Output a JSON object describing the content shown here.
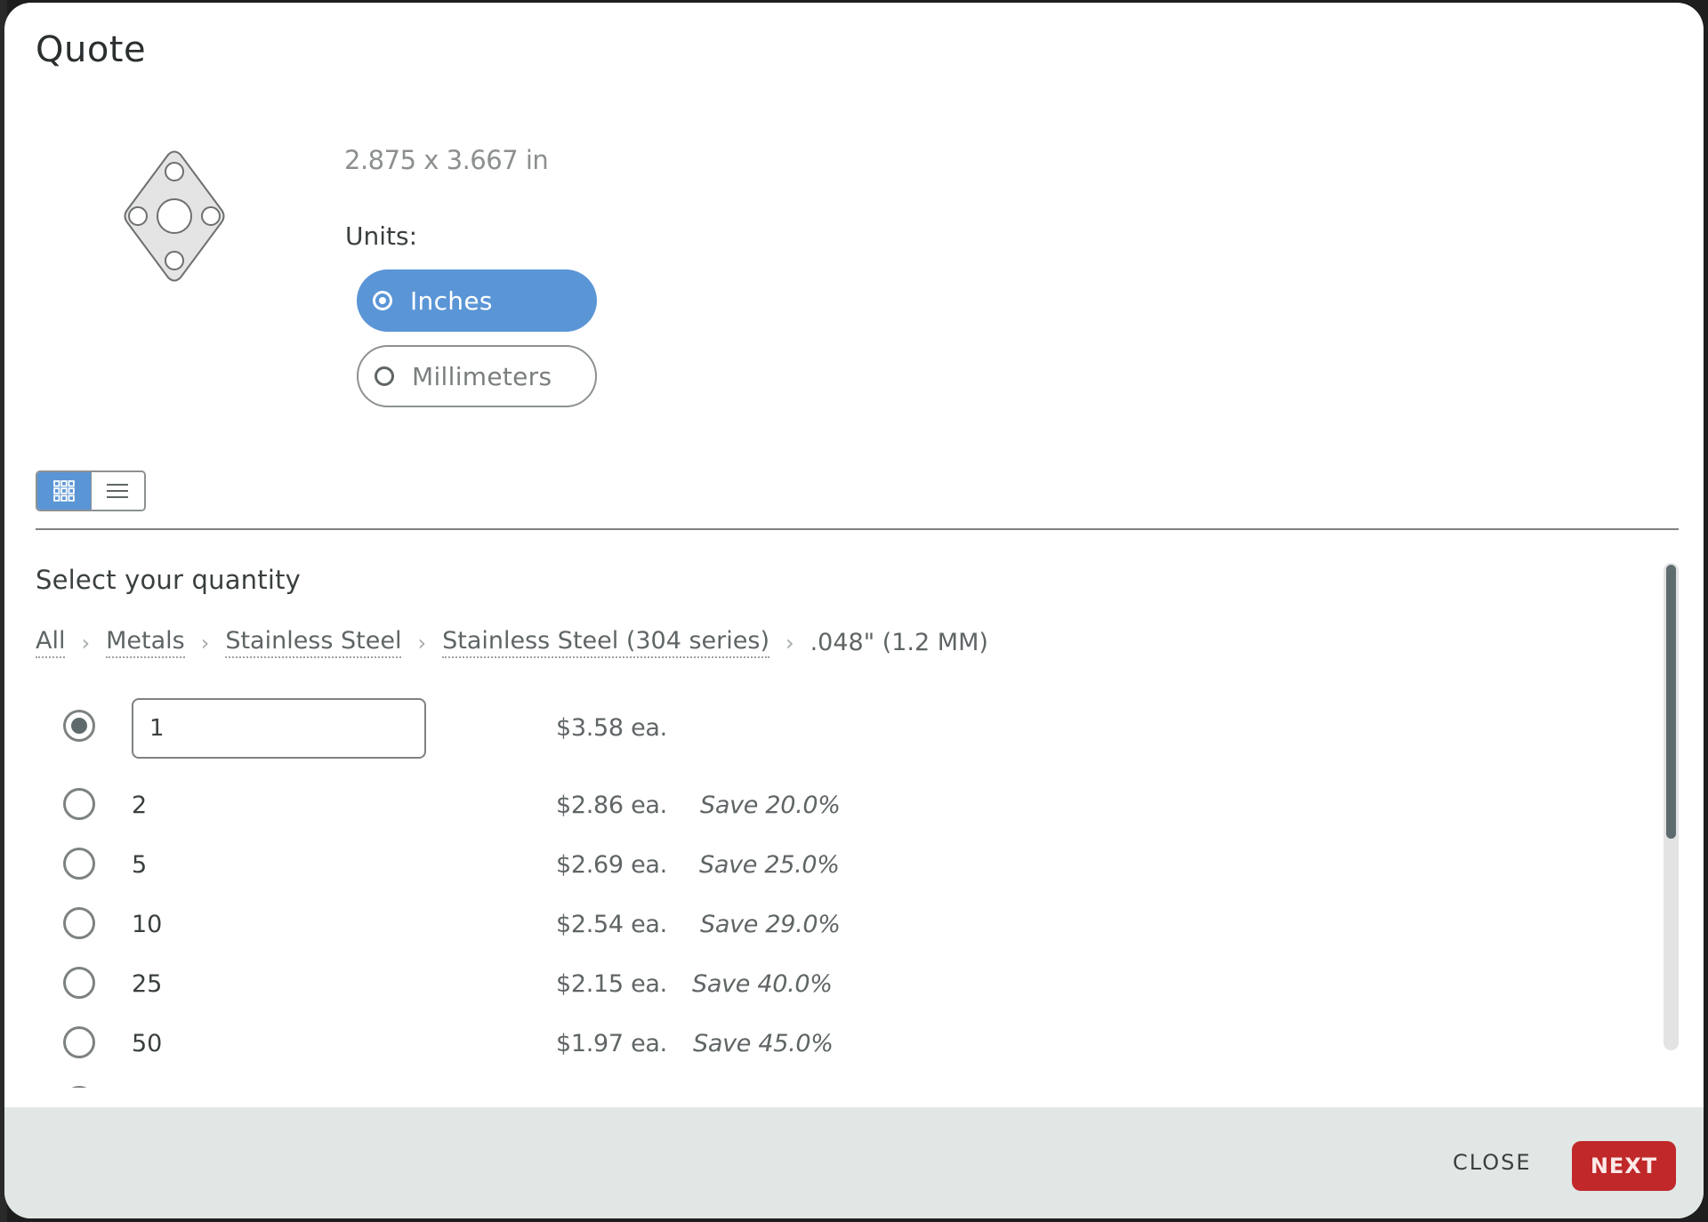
{
  "dialog": {
    "title": "Quote"
  },
  "part": {
    "dimensions": "2.875 x 3.667 in",
    "icon": "diamond-flange-part-icon"
  },
  "units": {
    "label": "Units:",
    "options": [
      {
        "label": "Inches",
        "selected": true
      },
      {
        "label": "Millimeters",
        "selected": false
      }
    ]
  },
  "view_toggle": {
    "options": [
      {
        "name": "grid-view",
        "icon": "grid-icon",
        "active": true
      },
      {
        "name": "list-view",
        "icon": "list-icon",
        "active": false
      }
    ]
  },
  "quantity": {
    "title": "Select your quantity",
    "breadcrumb": {
      "items": [
        "All",
        "Metals",
        "Stainless Steel",
        "Stainless Steel (304 series)"
      ],
      "current": ".048\" (1.2 MM)",
      "separator": "›"
    },
    "custom": {
      "value": "1",
      "price": "$3.58 ea.",
      "selected": true
    },
    "rows": [
      {
        "qty": "2",
        "price": "$2.86 ea.",
        "save": "Save 20.0%"
      },
      {
        "qty": "5",
        "price": "$2.69 ea.",
        "save": "Save 25.0%"
      },
      {
        "qty": "10",
        "price": "$2.54 ea.",
        "save": "Save 29.0%"
      },
      {
        "qty": "25",
        "price": "$2.15 ea.",
        "save": "Save 40.0%"
      },
      {
        "qty": "50",
        "price": "$1.97 ea.",
        "save": "Save 45.0%"
      }
    ]
  },
  "footer": {
    "close_label": "CLOSE",
    "next_label": "NEXT"
  },
  "colors": {
    "accent_blue": "#5a95d6",
    "next_red": "#c0282a",
    "footer_bg": "#e1e7e5",
    "text_dark": "#3a3f40",
    "text_muted": "#8c8f90"
  }
}
